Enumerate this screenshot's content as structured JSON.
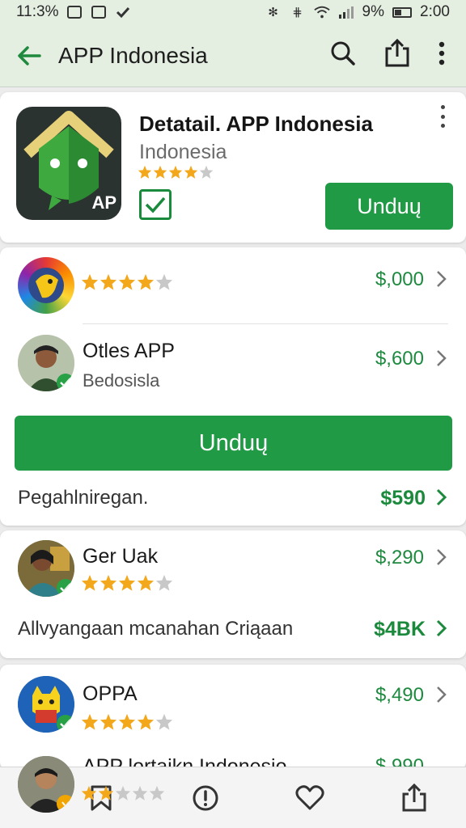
{
  "status_bar": {
    "time_left": "11:3%",
    "battery_text": "9%",
    "time_right": "2:00"
  },
  "app_bar": {
    "title": "APP Indonesia"
  },
  "detail": {
    "title": "Detatail. APP Indonesia",
    "subtitle": "Indonesia",
    "logo_text": "AP",
    "rating": 4,
    "download_label": "Unduų"
  },
  "list": [
    {
      "name": "",
      "rating": 4,
      "price": "$,000"
    },
    {
      "name": "Otles APP",
      "subtitle": "Bedosisla",
      "price": "$,600"
    }
  ],
  "big_download_label": "Unduų",
  "summary_1": {
    "text": "Pegahlniregan.",
    "price": "$590"
  },
  "card2": {
    "name": "Ger Uak",
    "rating": 4,
    "price": "$,290",
    "summary_text": "Allvyangaan mcanahan Criąaan",
    "summary_price": "$4BK"
  },
  "card3": {
    "name": "OPPA",
    "rating": 4,
    "price": "$,490",
    "partial_name": "APP lortaikn Indonesio",
    "partial_price": "$,990",
    "partial_rating": 2
  },
  "colors": {
    "green": "#219a45",
    "price_green": "#1e8a3f",
    "star": "#f3a81c",
    "star_empty": "#c8c8c8",
    "appbar_bg": "#e4efe2"
  }
}
